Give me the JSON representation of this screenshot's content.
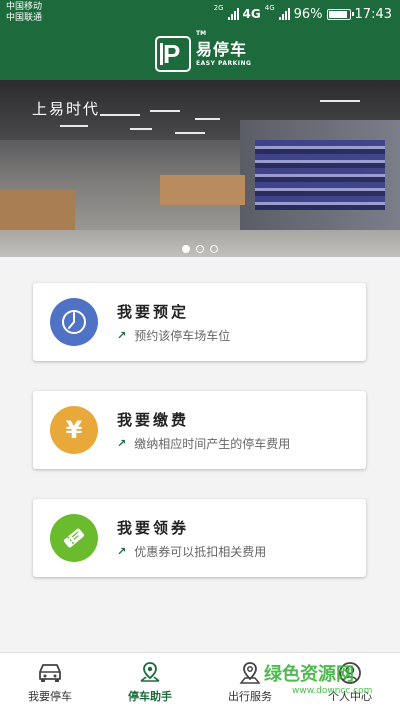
{
  "status_bar": {
    "carrier_1": "中国移动",
    "carrier_2": "中国联通",
    "net_1": "2G",
    "net_2": "4G",
    "net_3": "4G",
    "battery": "96%",
    "battery_level": 0.96,
    "time": "17:43"
  },
  "header": {
    "logo_mark": "P",
    "trademark": "TM",
    "app_name": "易停车",
    "app_name_en": "EASY PARKING"
  },
  "banner": {
    "sign_text": "上易时代",
    "slide_count": 3,
    "active_slide": 0
  },
  "cards": [
    {
      "title": "我要预定",
      "desc": "预约该停车场车位",
      "icon": "clock-icon",
      "color": "#4f72c4"
    },
    {
      "title": "我要缴费",
      "desc": "缴纳相应时间产生的停车费用",
      "icon": "yen-icon",
      "color": "#e8a93a"
    },
    {
      "title": "我要领券",
      "desc": "优惠券可以抵扣相关费用",
      "icon": "ticket-icon",
      "color": "#6bbb2e"
    }
  ],
  "bottom_nav": [
    {
      "label": "我要停车",
      "icon": "car-icon"
    },
    {
      "label": "停车助手",
      "icon": "map-pin-icon",
      "active": true
    },
    {
      "label": "出行服务",
      "icon": "location-icon"
    },
    {
      "label": "个人中心",
      "icon": "user-icon"
    }
  ],
  "watermark": {
    "brand": "绿色资源网",
    "url": "www.downcc.com"
  },
  "colors": {
    "brand_green": "#1d6b3c",
    "active_nav": "#1d6b3c"
  }
}
